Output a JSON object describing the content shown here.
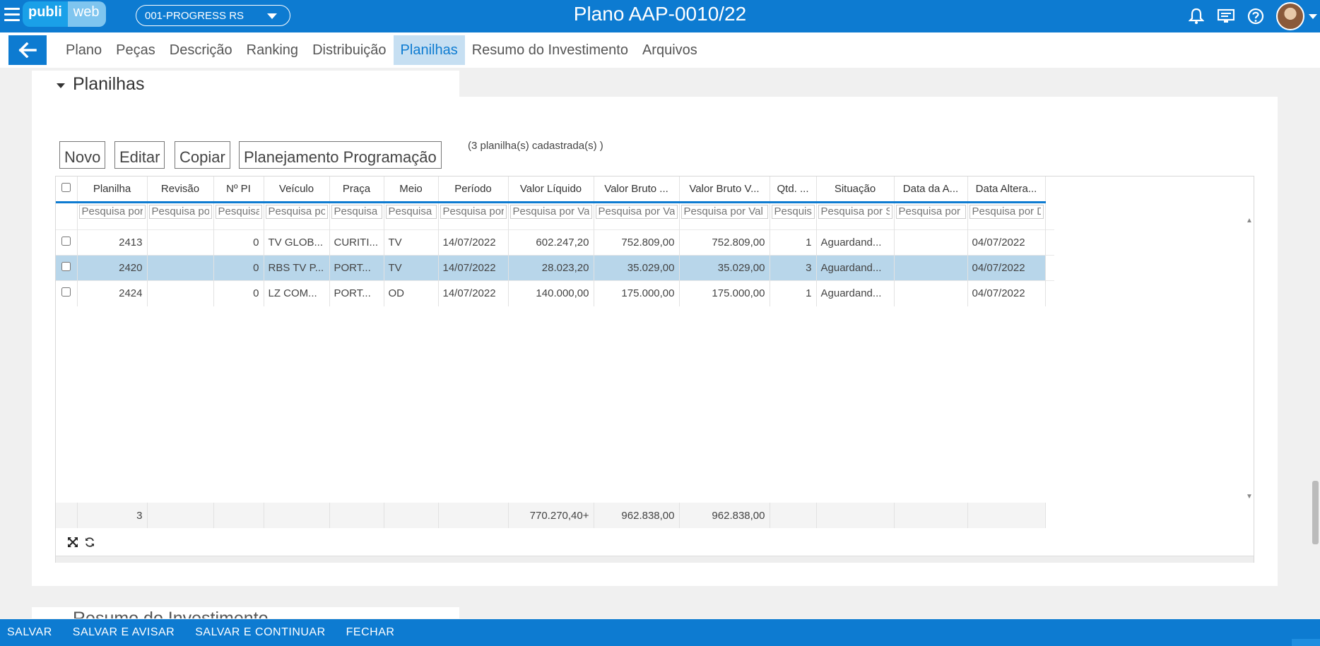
{
  "header": {
    "logo_part1": "publi",
    "logo_part2": "web",
    "agency": "001-PROGRESS RS",
    "title": "Plano AAP-0010/22",
    "icons": [
      "bell-icon",
      "monitor-icon",
      "help-icon"
    ]
  },
  "nav": {
    "tabs": [
      {
        "label": "Plano"
      },
      {
        "label": "Peças"
      },
      {
        "label": "Descrição"
      },
      {
        "label": "Ranking"
      },
      {
        "label": "Distribuição"
      },
      {
        "label": "Planilhas",
        "active": true
      },
      {
        "label": "Resumo do Investimento"
      },
      {
        "label": "Arquivos"
      }
    ]
  },
  "section": {
    "title": "Planilhas",
    "buttons": {
      "novo": "Novo",
      "editar": "Editar",
      "copiar": "Copiar",
      "planejamento": "Planejamento Programação"
    },
    "count_text": "(3   planilha(s) cadastrada(s) )"
  },
  "grid": {
    "columns": [
      "Planilha",
      "Revisão",
      "Nº PI",
      "Veículo",
      "Praça",
      "Meio",
      "Período",
      "Valor Líquido",
      "Valor Bruto ...",
      "Valor Bruto V...",
      "Qtd. ...",
      "Situação",
      "Data da A...",
      "Data Altera..."
    ],
    "filter_placeholders": [
      "Pesquisa por",
      "Pesquisa por",
      "Pesquisa",
      "Pesquisa por",
      "Pesquisa",
      "Pesquisa",
      "Pesquisa por",
      "Pesquisa por Va",
      "Pesquisa por Va",
      "Pesquisa por Val",
      "Pesquisa",
      "Pesquisa por S",
      "Pesquisa por",
      "Pesquisa por D"
    ],
    "rows": [
      {
        "planilha": "2413",
        "revisao": "",
        "pi": "0",
        "veiculo": "TV GLOB...",
        "praca": "CURITI...",
        "meio": "TV",
        "periodo": "14/07/2022",
        "valor_liquido": "602.247,20",
        "valor_bruto": "752.809,00",
        "valor_bruto_v": "752.809,00",
        "qtd": "1",
        "situacao": "Aguardand...",
        "data_a": "",
        "data_alteracao": "04/07/2022"
      },
      {
        "planilha": "2420",
        "revisao": "",
        "pi": "0",
        "veiculo": "RBS TV P...",
        "praca": "PORT...",
        "meio": "TV",
        "periodo": "14/07/2022",
        "valor_liquido": "28.023,20",
        "valor_bruto": "35.029,00",
        "valor_bruto_v": "35.029,00",
        "qtd": "3",
        "situacao": "Aguardand...",
        "data_a": "",
        "data_alteracao": "04/07/2022",
        "selected": true
      },
      {
        "planilha": "2424",
        "revisao": "",
        "pi": "0",
        "veiculo": "LZ COM...",
        "praca": "PORT...",
        "meio": "OD",
        "periodo": "14/07/2022",
        "valor_liquido": "140.000,00",
        "valor_bruto": "175.000,00",
        "valor_bruto_v": "175.000,00",
        "qtd": "1",
        "situacao": "Aguardand...",
        "data_a": "",
        "data_alteracao": "04/07/2022"
      }
    ],
    "totals": {
      "count": "3",
      "valor_liquido": "770.270,40+",
      "valor_bruto": "962.838,00",
      "valor_bruto_v": "962.838,00"
    }
  },
  "next_section": {
    "title": "Resumo do Investimento"
  },
  "actions": {
    "salvar": "SALVAR",
    "salvar_avisar": "SALVAR E AVISAR",
    "salvar_continuar": "SALVAR E CONTINUAR",
    "fechar": "FECHAR"
  },
  "colors": {
    "primary": "#0d7bd1",
    "active_tab_bg": "#c6dff2",
    "selected_row": "#b8d6ea"
  }
}
